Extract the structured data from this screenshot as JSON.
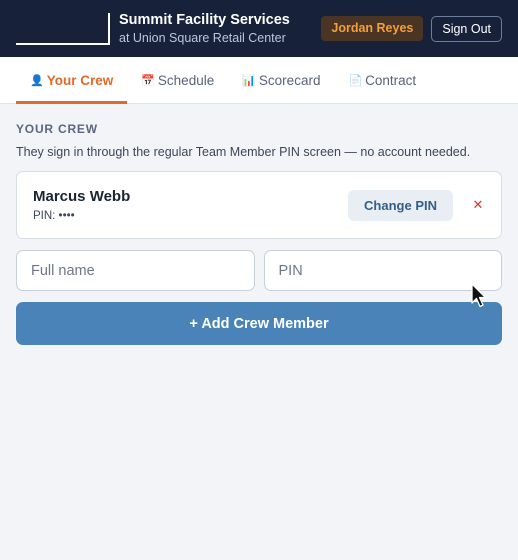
{
  "header": {
    "title": "Summit Facility Services",
    "subtitle": "at Union Square Retail Center",
    "user_name": "Jordan Reyes",
    "signout_label": "Sign Out"
  },
  "tabs": [
    {
      "icon": "👤",
      "icon_name": "person-icon",
      "label": "Your Crew",
      "active": true
    },
    {
      "icon": "📅",
      "icon_name": "calendar-icon",
      "label": "Schedule",
      "active": false
    },
    {
      "icon": "📊",
      "icon_name": "bar-chart-icon",
      "label": "Scorecard",
      "active": false
    },
    {
      "icon": "📄",
      "icon_name": "document-icon",
      "label": "Contract",
      "active": false
    }
  ],
  "crew_section": {
    "title": "YOUR CREW",
    "description": "They sign in through the regular Team Member PIN screen — no account needed.",
    "members": [
      {
        "name": "Marcus Webb",
        "pin_display": "PIN: ••••",
        "change_pin_label": "Change PIN",
        "remove_glyph": "✕"
      }
    ],
    "name_placeholder": "Full name",
    "pin_placeholder": "PIN",
    "add_label": "+ Add Crew Member"
  },
  "colors": {
    "header_bg": "#17223a",
    "accent_orange": "#e06a2a",
    "primary_blue": "#4a83b8",
    "remove_red": "#d23a2e"
  }
}
